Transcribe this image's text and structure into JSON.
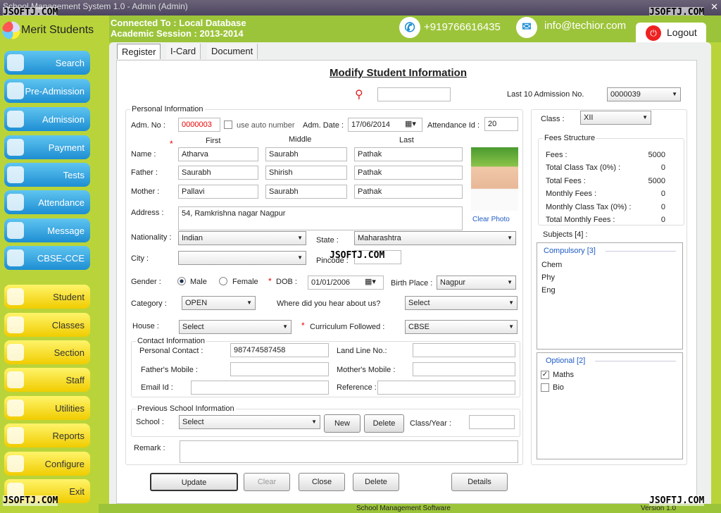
{
  "window": {
    "title": "School Management System 1.0  -  Admin (Admin)"
  },
  "watermark": "JSOFTJ.COM",
  "header": {
    "app_name": "Merit Students",
    "connected": "Connected To : Local Database",
    "session": "Academic Session : 2013-2014",
    "phone": "+919766616435",
    "email": "info@techior.com",
    "logout": "Logout"
  },
  "sidebar": {
    "top_items": [
      "Search",
      "Pre-Admission",
      "Admission",
      "Payment",
      "Tests",
      "Attendance",
      "Message",
      "CBSE-CCE"
    ],
    "bottom_items": [
      "Student",
      "Classes",
      "Section",
      "Staff",
      "Utilities",
      "Reports",
      "Configure",
      "Exit"
    ]
  },
  "tabs": [
    "Register",
    "I-Card",
    "Document"
  ],
  "form": {
    "title": "Modify Student Information",
    "search_value": "",
    "last10_label": "Last 10 Admission No.",
    "last10_value": "0000039",
    "personal_group": "Personal Information",
    "adm_no_label": "Adm. No :",
    "adm_no": "0000003",
    "auto_label": "use auto number",
    "adm_date_label": "Adm. Date :",
    "adm_date": "17/06/2014",
    "att_label": "Attendance Id  :",
    "att_id": "20",
    "col_first": "First",
    "col_middle": "Middle",
    "col_last": "Last",
    "names": [
      {
        "label": "Name :",
        "first": "Atharva",
        "middle": "Saurabh",
        "last": "Pathak"
      },
      {
        "label": "Father :",
        "first": "Saurabh",
        "middle": "Shirish",
        "last": "Pathak"
      },
      {
        "label": "Mother :",
        "first": "Pallavi",
        "middle": "Saurabh",
        "last": "Pathak"
      }
    ],
    "clear_photo": "Clear Photo",
    "address_label": "Address :",
    "address": "54, Ramkrishna nagar Nagpur",
    "nationality_label": "Nationality :",
    "nationality": "Indian",
    "state_label": "State :",
    "state": "Maharashtra",
    "city_label": "City :",
    "city": "",
    "pincode_label": "Pincode :",
    "pincode": "",
    "gender_label": "Gender :",
    "male": "Male",
    "female": "Female",
    "dob_label": "DOB :",
    "dob": "01/01/2006",
    "birthplace_label": "Birth Place :",
    "birthplace": "Nagpur",
    "category_label": "Category :",
    "category": "OPEN",
    "hear_label": "Where did you hear about us?",
    "hear": "Select",
    "house_label": "House :",
    "house": "Select",
    "curriculum_label": "Curriculum Followed :",
    "curriculum": "CBSE",
    "contact_group": "Contact Information",
    "personal_contact_label": "Personal Contact :",
    "personal_contact": "987474587458",
    "landline_label": "Land Line No.:",
    "landline": "",
    "father_mobile_label": "Father's Mobile :",
    "father_mobile": "",
    "mother_mobile_label": "Mother's Mobile :",
    "mother_mobile": "",
    "email_label": "Email Id :",
    "email": "",
    "reference_label": "Reference :",
    "reference": "",
    "prev_group": "Previous School Information",
    "school_label": "School :",
    "school": "Select",
    "new": "New",
    "delete": "Delete",
    "classyear_label": "Class/Year :",
    "classyear": "",
    "remark_label": "Remark :",
    "remark": ""
  },
  "right": {
    "class_label": "Class :",
    "class": "XII",
    "fees_group": "Fees Structure",
    "fees": [
      [
        "Fees :",
        "5000"
      ],
      [
        "Total Class Tax (0%) :",
        "0"
      ],
      [
        "Total Fees :",
        "5000"
      ],
      [
        "Monthly Fees :",
        "0"
      ],
      [
        "Monthly Class Tax (0%) :",
        "0"
      ],
      [
        "Total Monthly Fees :",
        "0"
      ]
    ],
    "subjects_label": "Subjects [4] :",
    "compulsory_label": "Compulsory [3]",
    "compulsory": [
      "Chem",
      "Phy",
      "Eng"
    ],
    "optional_label": "Optional [2]",
    "optional": [
      {
        "name": "Maths",
        "checked": true
      },
      {
        "name": "Bio",
        "checked": false
      }
    ]
  },
  "buttons": {
    "update": "Update",
    "clear": "Clear",
    "close": "Close",
    "delete": "Delete",
    "details": "Details"
  },
  "footer": {
    "center": "School Management Software",
    "version": "Version 1.0"
  }
}
